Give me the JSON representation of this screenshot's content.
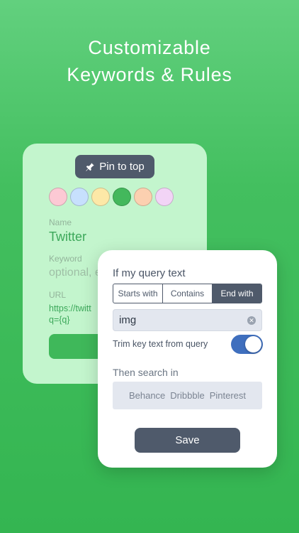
{
  "headline": {
    "line1": "Customizable",
    "line2": "Keywords & Rules"
  },
  "back_card": {
    "pin_button_label": "Pin to top",
    "swatches": [
      "#fcc9d4",
      "#c7e0fd",
      "#fde8a7",
      "#43b85c",
      "#fcd0b0",
      "#f2d4f6"
    ],
    "name_label": "Name",
    "name_value": "Twitter",
    "keyword_label": "Keyword",
    "keyword_placeholder": "optional, e",
    "url_label": "URL",
    "url_line1": "https://twitt",
    "url_line2": "q={q}"
  },
  "front_card": {
    "title": "If my query text",
    "segments": [
      "Starts with",
      "Contains",
      "End with"
    ],
    "selected_segment": "End with",
    "query_value": "img",
    "trim_label": "Trim key text from query",
    "trim_enabled": true,
    "then_label": "Then search in",
    "engines": [
      "Behance",
      "Dribbble",
      "Pinterest"
    ],
    "save_label": "Save"
  },
  "colors": {
    "background": "#43bf5f",
    "back_card": "#c3f5cd",
    "accent_green": "#3ca85a",
    "dark_button": "#4f5a6b",
    "toggle_on": "#3f6fbe"
  }
}
